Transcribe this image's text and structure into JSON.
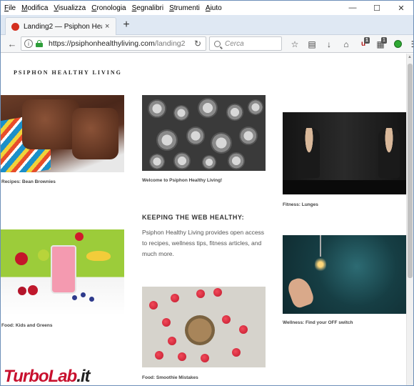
{
  "menubar": {
    "items": [
      "File",
      "Modifica",
      "Visualizza",
      "Cronologia",
      "Segnalibri",
      "Strumenti",
      "Aiuto"
    ]
  },
  "window_controls": {
    "minimize": "—",
    "maximize": "☐",
    "close": "✕"
  },
  "tab": {
    "title": "Landing2 — Psiphon Heal...",
    "close": "×",
    "new_tab": "+"
  },
  "navbar": {
    "url_host": "https://psiphonhealthyliving.com",
    "url_path": "/landing2",
    "search_placeholder": "Cerca",
    "ublock_badge": "1",
    "ext_badge": "1"
  },
  "site": {
    "logo": "PSIPHON HEALTHY LIVING",
    "cards": [
      {
        "caption": "Recipes: Bean Brownies"
      },
      {
        "caption": "Welcome to Psiphon Healthy Living!"
      },
      {
        "caption": "Fitness: Lunges"
      },
      {
        "caption": "Food: Kids and Greens"
      },
      {
        "caption": "Wellness: Find your OFF switch"
      },
      {
        "caption": "Food: Smoothie Mistakes"
      }
    ],
    "section_heading": "KEEPING THE WEB HEALTHY:",
    "section_text": "Psiphon Healthy Living provides open access to recipes, wellness tips, fitness articles, and much more."
  },
  "watermark": {
    "brand": "TurboLab",
    "tld": ".it"
  },
  "colors": {
    "accent_red": "#c8102e",
    "tab_bg": "#dfe8f3",
    "lock_green": "#2e9e3a"
  }
}
